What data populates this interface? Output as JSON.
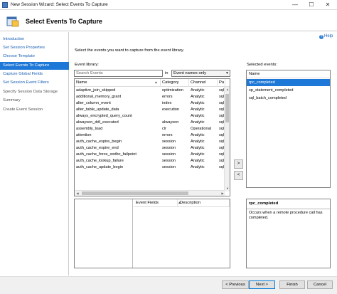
{
  "window": {
    "title": "New Session Wizard: Select Events To Capture",
    "minimize_glyph": "—",
    "maximize_glyph": "☐",
    "close_glyph": "✕"
  },
  "header": {
    "title": "Select Events To Capture"
  },
  "sidebar": {
    "items": [
      {
        "label": "Introduction",
        "state": "link"
      },
      {
        "label": "Set Session Properties",
        "state": "link"
      },
      {
        "label": "Choose Template",
        "state": "link"
      },
      {
        "label": "Select Events To Capture",
        "state": "active"
      },
      {
        "label": "Capture Global Fields",
        "state": "link"
      },
      {
        "label": "Set Session Event Filters",
        "state": "link"
      },
      {
        "label": "Specify Session Data Storage",
        "state": "disabled"
      },
      {
        "label": "Summary",
        "state": "disabled"
      },
      {
        "label": "Create Event Session",
        "state": "disabled"
      }
    ]
  },
  "help": {
    "label": "Help",
    "icon": "help-icon",
    "icon_glyph": "?"
  },
  "main": {
    "instruction": "Select the events you want to capture from the event library.",
    "library_label": "Event library:",
    "search_placeholder": "Search Events",
    "in_label": "in",
    "filter_selected": "Event names only",
    "selected_label": "Selected events:"
  },
  "library": {
    "columns": [
      "Name",
      "Category",
      "Channel",
      "Pa"
    ],
    "sort_glyph": "▲",
    "rows": [
      [
        "adaptive_join_skipped",
        "optimization",
        "Analytic",
        "sql"
      ],
      [
        "additional_memory_grant",
        "errors",
        "Analytic",
        "sql"
      ],
      [
        "alter_column_event",
        "index",
        "Analytic",
        "sql"
      ],
      [
        "alter_table_update_data",
        "execution",
        "Analytic",
        "sql"
      ],
      [
        "always_encrypted_query_count",
        "",
        "Analytic",
        "sql"
      ],
      [
        "alwayson_ddl_executed",
        "alwayson",
        "Analytic",
        "sql"
      ],
      [
        "assembly_load",
        "clr",
        "Operational",
        "sql"
      ],
      [
        "attention",
        "errors",
        "Analytic",
        "sql"
      ],
      [
        "auth_cache_expire_begin",
        "session",
        "Analytic",
        "sql"
      ],
      [
        "auth_cache_expire_end",
        "session",
        "Analytic",
        "sql"
      ],
      [
        "auth_cache_force_xodbc_failpoint",
        "session",
        "Analytic",
        "sql"
      ],
      [
        "auth_cache_lookup_failure",
        "session",
        "Analytic",
        "sql"
      ],
      [
        "auth_cache_update_begin",
        "session",
        "Analytic",
        "sql"
      ]
    ],
    "scroll_up_glyph": "▲",
    "scroll_down_glyph": "▼",
    "scroll_left_glyph": "◀",
    "scroll_right_glyph": "▶"
  },
  "move_buttons": {
    "add": ">",
    "remove": "<"
  },
  "selected": {
    "header": "Name",
    "rows": [
      "rpc_completed",
      "sp_statement_completed",
      "sql_batch_completed"
    ],
    "selected_index": 0
  },
  "fields": {
    "col1": "Event Fields",
    "col2": "Description",
    "sort_glyph": "▲"
  },
  "description": {
    "title": "rpc_completed",
    "text": "Occurs when a remote procedure call has completed."
  },
  "footer": {
    "previous": "< Previous",
    "next": "Next >",
    "finish": "Finish",
    "cancel": "Cancel"
  },
  "colors": {
    "accent": "#1e78d7",
    "link": "#1a5fb4"
  }
}
